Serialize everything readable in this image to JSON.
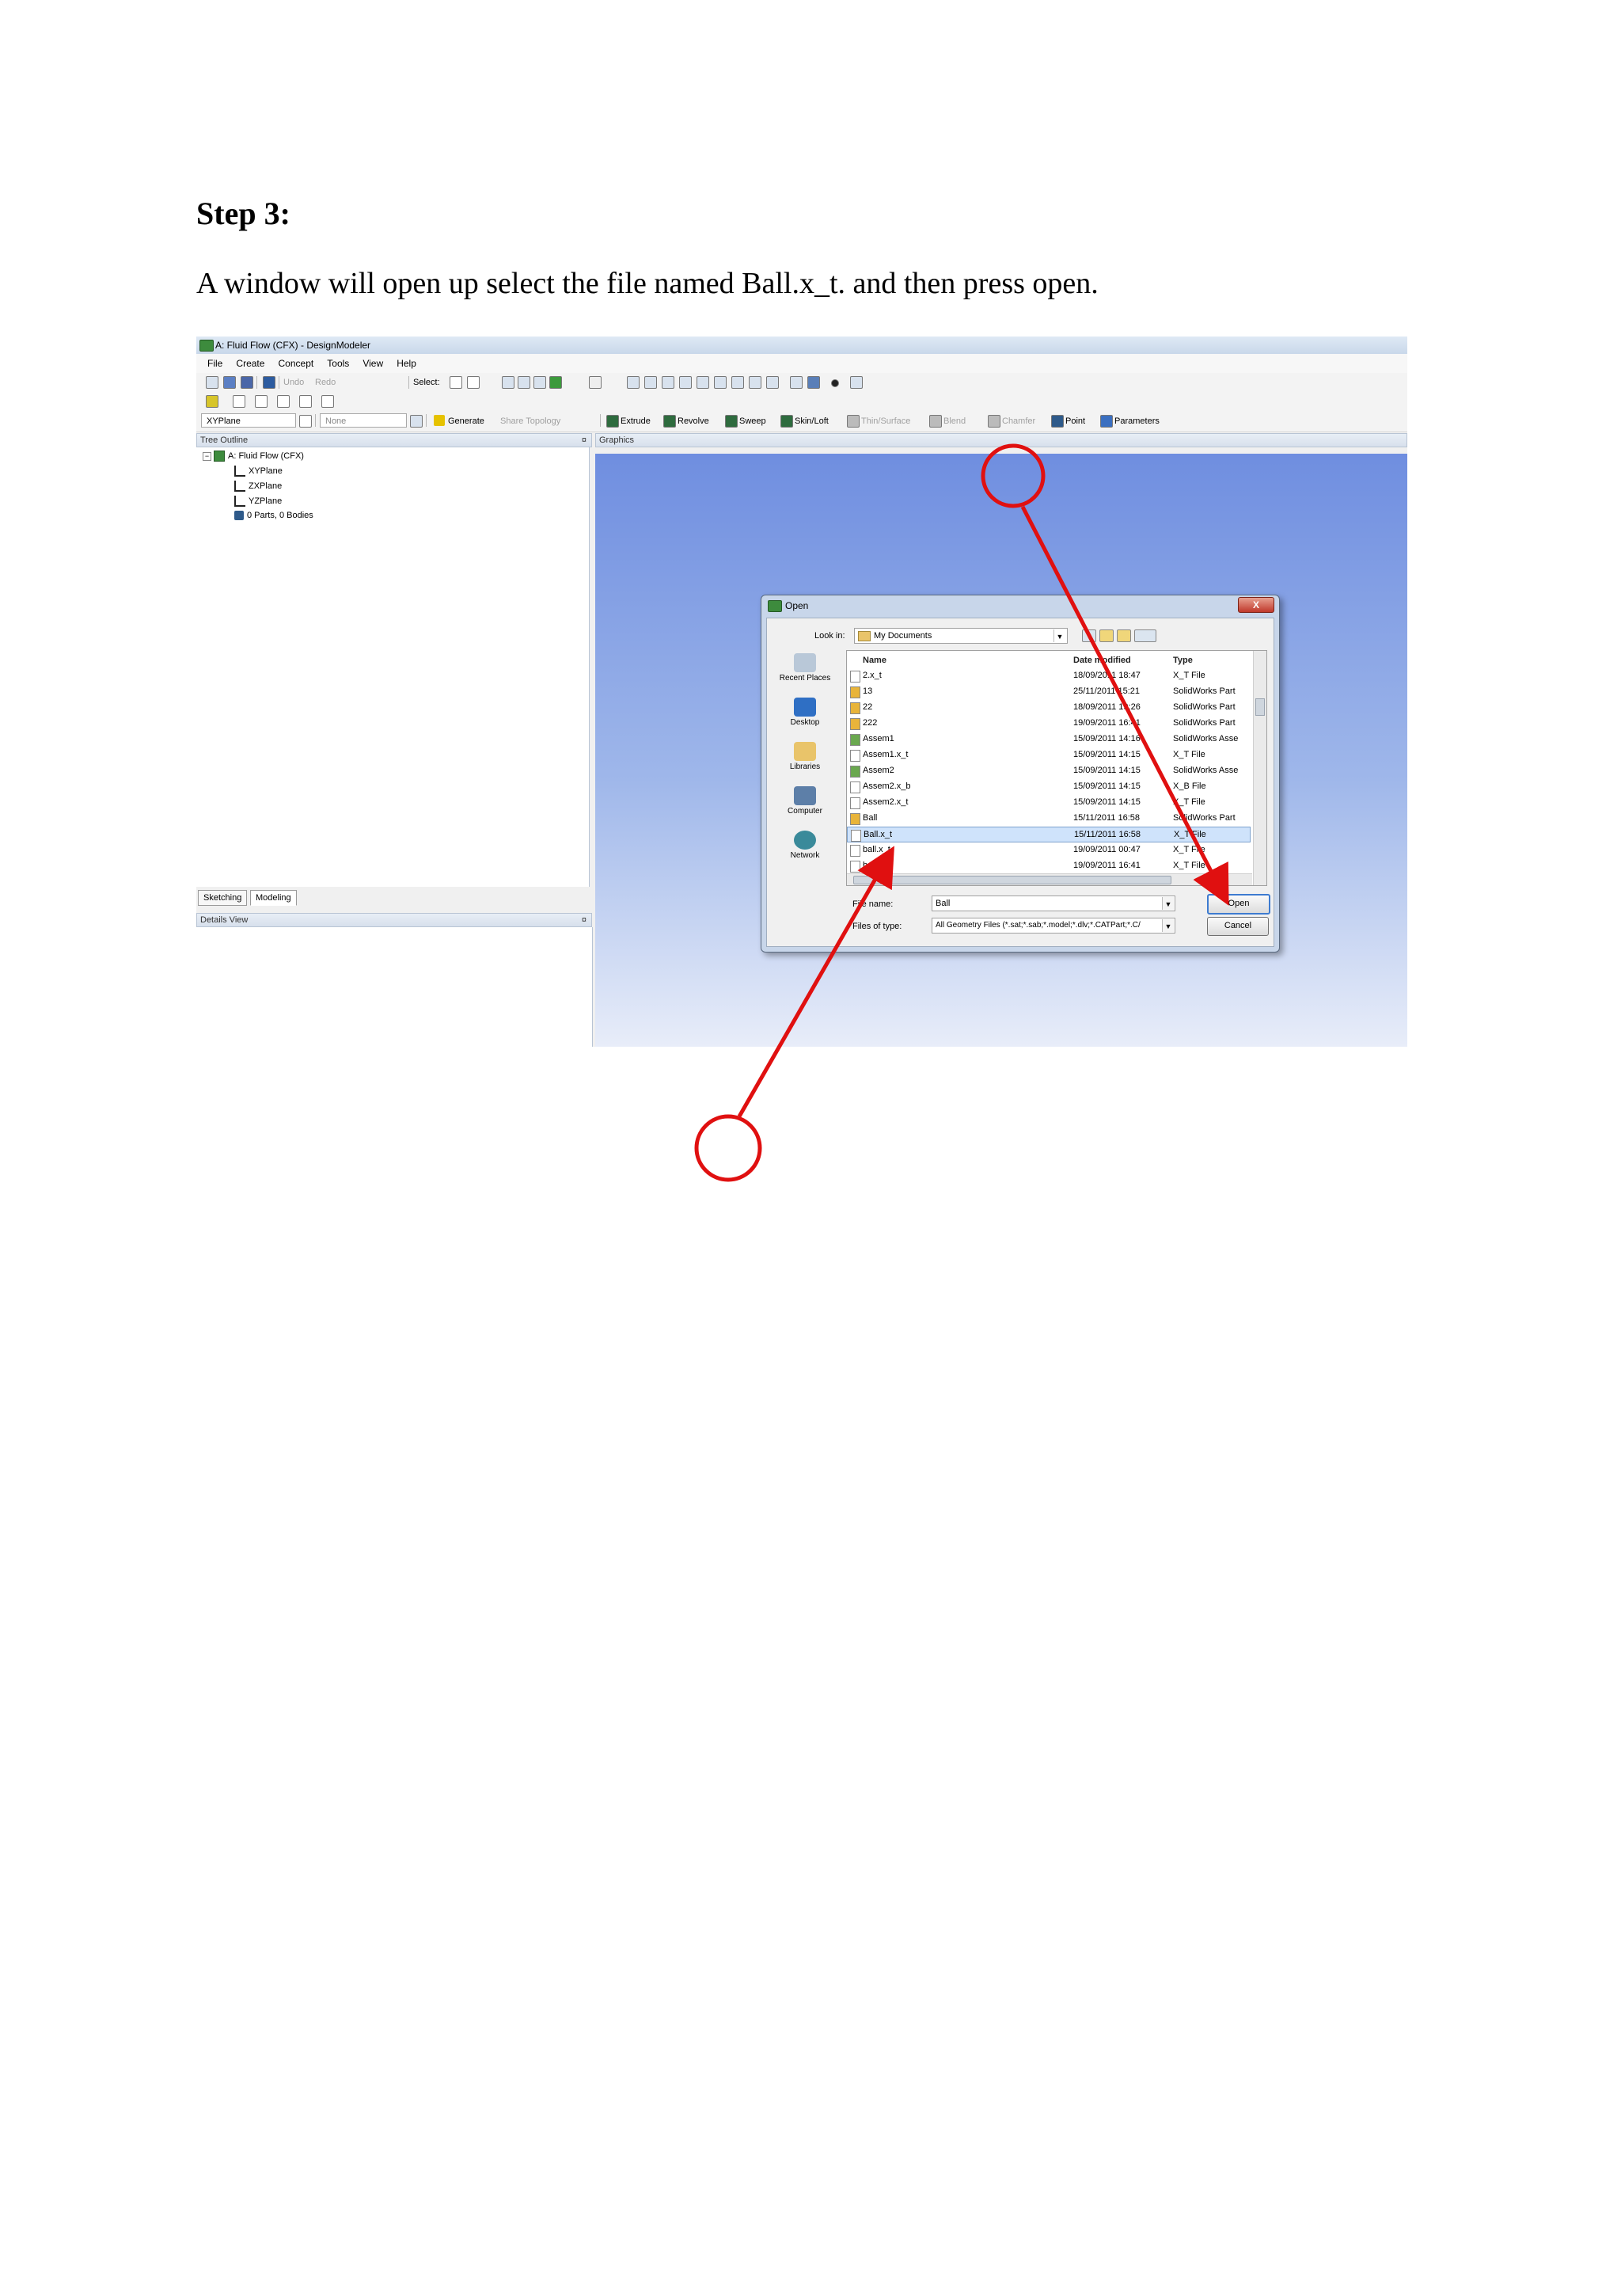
{
  "doc": {
    "heading": "Step 3:",
    "instruction": "A window will open up select the file named Ball.x_t. and then press open."
  },
  "app": {
    "title": "A: Fluid Flow (CFX) - DesignModeler",
    "menu": [
      "File",
      "Create",
      "Concept",
      "Tools",
      "View",
      "Help"
    ],
    "toolbar1": {
      "undo": "Undo",
      "redo": "Redo",
      "select": "Select:"
    },
    "toolbar3": {
      "plane_combo": "XYPlane",
      "sketch_combo": "None",
      "generate": "Generate",
      "share_topology": "Share Topology",
      "extrude": "Extrude",
      "revolve": "Revolve",
      "sweep": "Sweep",
      "skin_loft": "Skin/Loft",
      "thin_surface": "Thin/Surface",
      "blend": "Blend",
      "chamfer": "Chamfer",
      "point": "Point",
      "parameters": "Parameters"
    },
    "tree_outline": {
      "title": "Tree Outline",
      "root": "A: Fluid Flow (CFX)",
      "children": [
        "XYPlane",
        "ZXPlane",
        "YZPlane",
        "0 Parts, 0 Bodies"
      ]
    },
    "graphics_title": "Graphics",
    "tabs": [
      "Sketching",
      "Modeling"
    ],
    "details_title": "Details View",
    "pin_glyph": "¤"
  },
  "dialog": {
    "title": "Open",
    "close": "X",
    "look_in_label": "Look in:",
    "look_in_value": "My Documents",
    "places": [
      "Recent Places",
      "Desktop",
      "Libraries",
      "Computer",
      "Network"
    ],
    "columns": [
      "Name",
      "Date modified",
      "Type"
    ],
    "files": [
      {
        "name": "2.x_t",
        "date": "18/09/2011 18:47",
        "type": "X_T File",
        "icon": "doc"
      },
      {
        "name": "13",
        "date": "25/11/2011 15:21",
        "type": "SolidWorks Part",
        "icon": "sw-part"
      },
      {
        "name": "22",
        "date": "18/09/2011 19:26",
        "type": "SolidWorks Part",
        "icon": "sw-part"
      },
      {
        "name": "222",
        "date": "19/09/2011 16:41",
        "type": "SolidWorks Part",
        "icon": "sw-part"
      },
      {
        "name": "Assem1",
        "date": "15/09/2011 14:16",
        "type": "SolidWorks Asse",
        "icon": "sw-assem"
      },
      {
        "name": "Assem1.x_t",
        "date": "15/09/2011 14:15",
        "type": "X_T File",
        "icon": "doc"
      },
      {
        "name": "Assem2",
        "date": "15/09/2011 14:15",
        "type": "SolidWorks Asse",
        "icon": "sw-assem"
      },
      {
        "name": "Assem2.x_b",
        "date": "15/09/2011 14:15",
        "type": "X_B File",
        "icon": "doc"
      },
      {
        "name": "Assem2.x_t",
        "date": "15/09/2011 14:15",
        "type": "X_T File",
        "icon": "doc"
      },
      {
        "name": "Ball",
        "date": "15/11/2011 16:58",
        "type": "SolidWorks Part",
        "icon": "sw-part"
      },
      {
        "name": "Ball.x_t",
        "date": "15/11/2011 16:58",
        "type": "X_T File",
        "icon": "doc",
        "selected": true
      },
      {
        "name": "ball.x_t",
        "date": "19/09/2011 00:47",
        "type": "X_T File",
        "icon": "doc"
      },
      {
        "name": "box.x_t",
        "date": "19/09/2011 16:41",
        "type": "X_T File",
        "icon": "doc"
      }
    ],
    "file_name_label": "File name:",
    "file_name_value": "Ball",
    "file_type_label": "Files of type:",
    "file_type_value": "All Geometry Files (*.sat;*.sab;*.model;*.dlv;*.CATPart;*.C/",
    "open_button": "Open",
    "cancel_button": "Cancel"
  },
  "colors": {
    "annotation": "#e01010",
    "selection": "#cfe3fb"
  }
}
